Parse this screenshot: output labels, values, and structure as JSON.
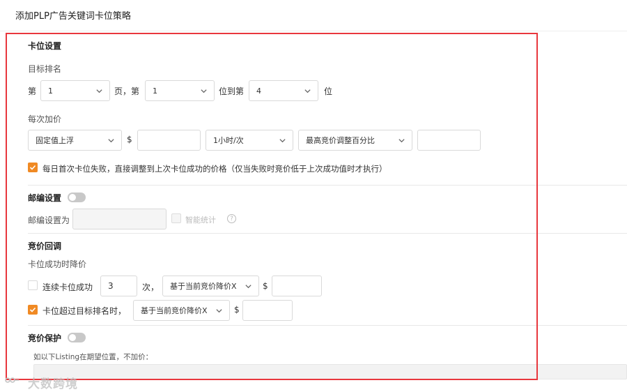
{
  "page": {
    "title": "添加PLP广告关键词卡位策略"
  },
  "slot": {
    "heading": "卡位设置",
    "target_rank_label": "目标排名",
    "prefix_di": "第",
    "page_value": "1",
    "page_suffix": "页，第",
    "pos_from": "1",
    "pos_to_label": "位到第",
    "pos_to": "4",
    "pos_suffix": "位",
    "increment_label": "每次加价",
    "mode_value": "固定值上浮",
    "currency": "$",
    "amount_value": "",
    "freq_value": "1小时/次",
    "max_adjust_value": "最高竞价调整百分比",
    "max_adjust_input": "",
    "fail_checkbox_label": "每日首次卡位失败，直接调整到上次卡位成功的价格（仅当失败时竞价低于上次成功值时才执行）"
  },
  "zip": {
    "heading": "邮编设置",
    "label": "邮编设置为",
    "value": "",
    "smart_label": "智能统计",
    "help_glyph": "?"
  },
  "bid_back": {
    "heading": "竞价回调",
    "sub_label": "卡位成功时降价",
    "row1_label": "连续卡位成功",
    "row1_count": "3",
    "row1_unit": "次，",
    "row1_select": "基于当前竞价降价X",
    "currency": "$",
    "row1_amount": "",
    "row2_label": "卡位超过目标排名时，",
    "row2_select": "基于当前竞价降价X",
    "row2_amount": ""
  },
  "protect": {
    "heading": "竞价保护",
    "desc": "如以下Listing在期望位置，不加价："
  },
  "watermark": {
    "text": "大数跨境"
  },
  "icons": {
    "chevron": "chevron-down-icon",
    "check": "check-icon",
    "help": "help-circle-icon",
    "watermark": "watermark-logo"
  },
  "colors": {
    "accent": "#f08a24",
    "highlight_box": "#e8373d",
    "toggle_off": "#c8c8c8"
  }
}
